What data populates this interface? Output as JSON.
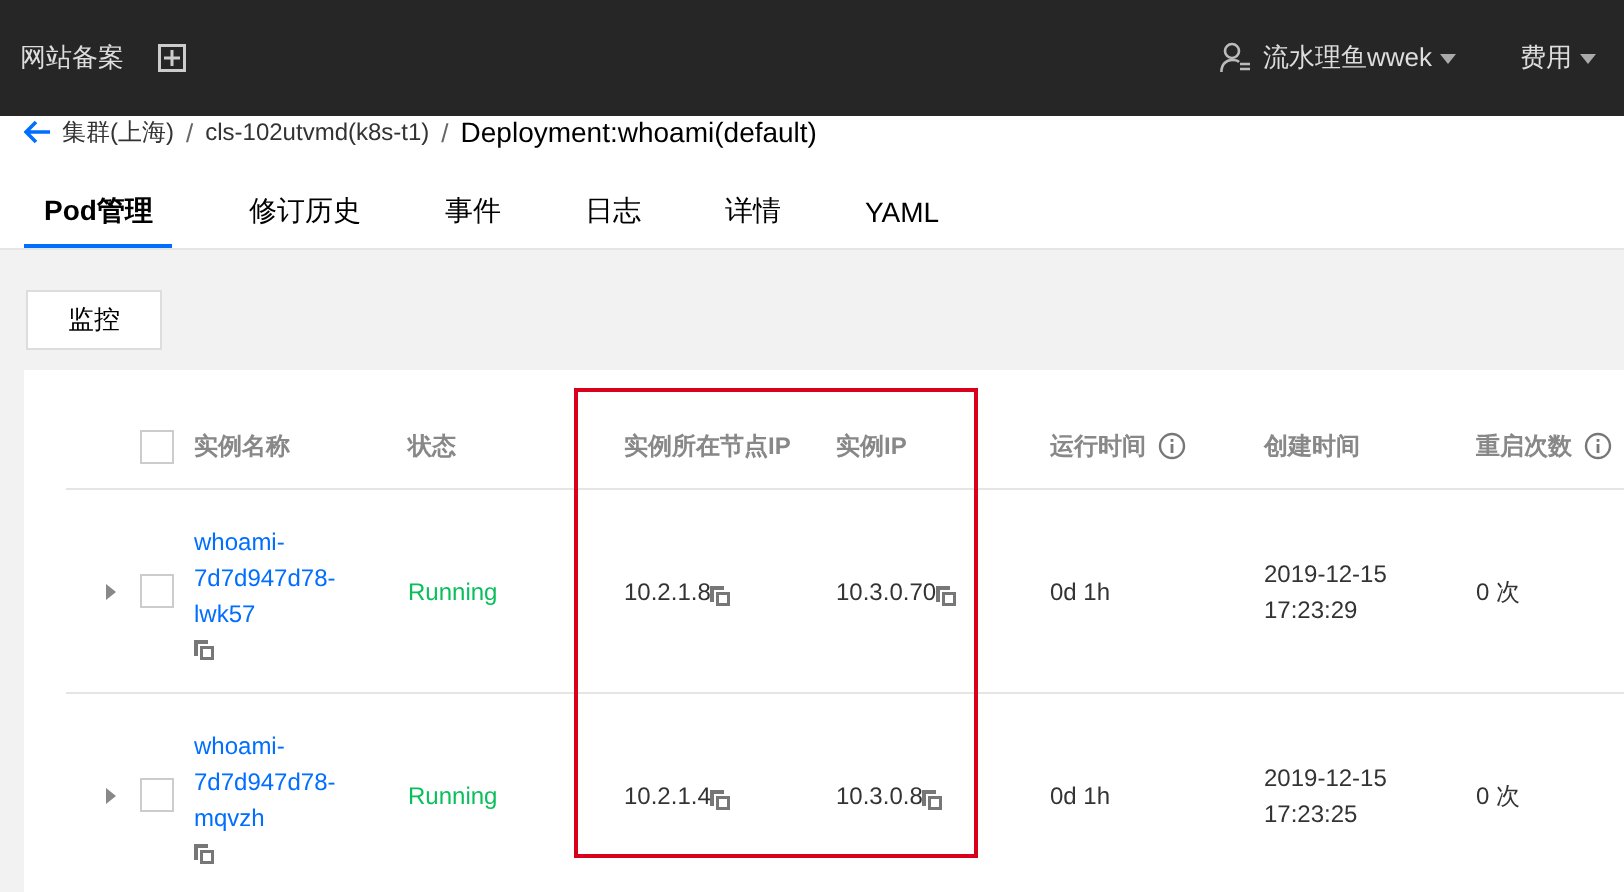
{
  "topbar": {
    "left_link": "网站备案",
    "user": "流水理鱼wwek",
    "menu": "费用"
  },
  "breadcrumb": {
    "items": [
      "集群(上海)",
      "cls-102utvmd(k8s-t1)"
    ],
    "separator": "/",
    "current": "Deployment:whoami(default)"
  },
  "tabs": [
    {
      "label": "Pod管理",
      "selected": true
    },
    {
      "label": "修订历史",
      "selected": false
    },
    {
      "label": "事件",
      "selected": false
    },
    {
      "label": "日志",
      "selected": false
    },
    {
      "label": "详情",
      "selected": false
    },
    {
      "label": "YAML",
      "selected": false
    }
  ],
  "toolbar": {
    "button": "监控"
  },
  "table": {
    "select_all_checked": false,
    "columns": [
      {
        "label": "实例名称",
        "info": false
      },
      {
        "label": "状态",
        "info": false
      },
      {
        "label": "实例所在节点IP",
        "info": false
      },
      {
        "label": "实例IP",
        "info": false
      },
      {
        "label": "运行时间",
        "info": true
      },
      {
        "label": "创建时间",
        "info": false
      },
      {
        "label": "重启次数",
        "info": true
      }
    ],
    "rows": [
      {
        "expanded": false,
        "checked": false,
        "name": [
          "whoami-",
          "7d7d947d78-",
          "lwk57"
        ],
        "status": "Running",
        "node_ip": "10.2.1.8",
        "pod_ip": "10.3.0.70",
        "runtime": "0d 1h",
        "created": [
          "2019-12-15",
          "17:23:29"
        ],
        "restarts": "0 次"
      },
      {
        "expanded": false,
        "checked": false,
        "name": [
          "whoami-",
          "7d7d947d78-",
          "mqvzh"
        ],
        "status": "Running",
        "node_ip": "10.2.1.4",
        "pod_ip": "10.3.0.8",
        "runtime": "0d 1h",
        "created": [
          "2019-12-15",
          "17:23:25"
        ],
        "restarts": "0 次"
      }
    ]
  }
}
